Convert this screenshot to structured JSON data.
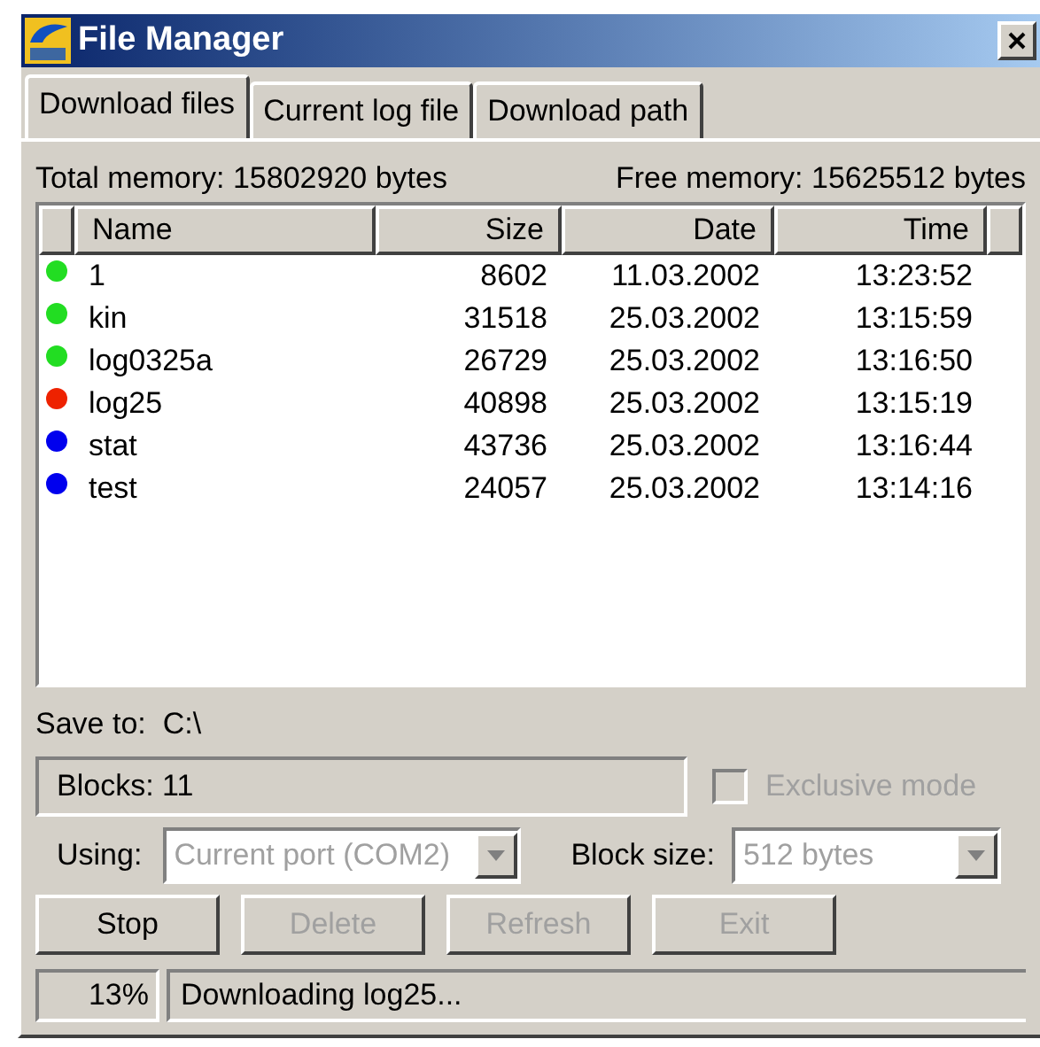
{
  "window": {
    "title": "File Manager"
  },
  "tabs": [
    {
      "label": "Download files",
      "selected": true
    },
    {
      "label": "Current log file",
      "selected": false
    },
    {
      "label": "Download path",
      "selected": false
    }
  ],
  "memory": {
    "total": "Total memory: 15802920 bytes",
    "free": "Free memory: 15625512 bytes"
  },
  "table": {
    "columns": [
      "Name",
      "Size",
      "Date",
      "Time"
    ],
    "rows": [
      {
        "color": "#22dd22",
        "cells": [
          "1",
          "8602",
          "11.03.2002",
          "13:23:52"
        ]
      },
      {
        "color": "#22dd22",
        "cells": [
          "kin",
          "31518",
          "25.03.2002",
          "13:15:59"
        ]
      },
      {
        "color": "#22dd22",
        "cells": [
          "log0325a",
          "26729",
          "25.03.2002",
          "13:16:50"
        ]
      },
      {
        "color": "#ee2200",
        "cells": [
          "log25",
          "40898",
          "25.03.2002",
          "13:15:19"
        ]
      },
      {
        "color": "#0000ee",
        "cells": [
          "stat",
          "43736",
          "25.03.2002",
          "13:16:44"
        ]
      },
      {
        "color": "#0000ee",
        "cells": [
          "test",
          "24057",
          "25.03.2002",
          "13:14:16"
        ]
      }
    ]
  },
  "save_to": "Save to:  C:\\",
  "blocks": "Blocks: 11",
  "exclusive_mode": {
    "label": "Exclusive mode",
    "checked": false,
    "disabled": true
  },
  "using": {
    "label": "Using:",
    "value": "Current port (COM2)",
    "disabled": true
  },
  "block_size": {
    "label": "Block size:",
    "value": "512 bytes",
    "disabled": true
  },
  "buttons": [
    {
      "label": "Stop",
      "disabled": false
    },
    {
      "label": "Delete",
      "disabled": true
    },
    {
      "label": "Refresh",
      "disabled": true
    },
    {
      "label": "Exit",
      "disabled": true
    }
  ],
  "status_bar": {
    "progress": "13%",
    "message": "Downloading log25..."
  }
}
